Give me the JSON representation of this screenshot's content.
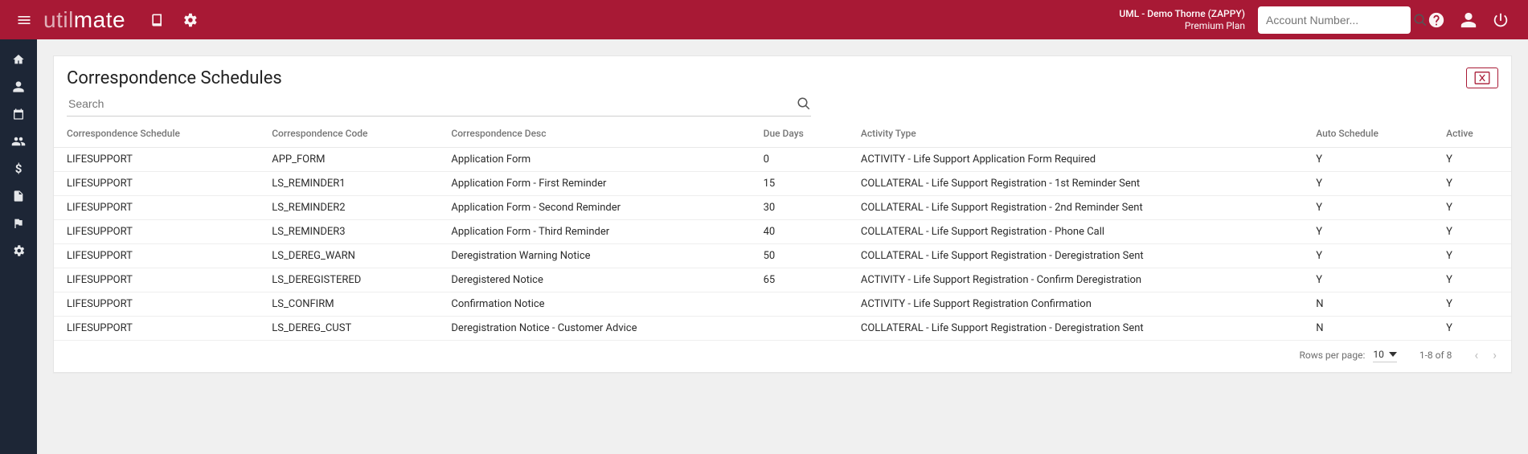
{
  "header": {
    "logo_light": "util",
    "logo_bold": "mate",
    "account_line1": "UML - Demo Thorne (ZAPPY)",
    "account_line2": "Premium Plan",
    "search_placeholder": "Account Number..."
  },
  "page": {
    "title": "Correspondence Schedules",
    "filter_placeholder": "Search"
  },
  "columns": [
    "Correspondence Schedule",
    "Correspondence Code",
    "Correspondence Desc",
    "Due Days",
    "Activity Type",
    "Auto Schedule",
    "Active"
  ],
  "rows": [
    {
      "schedule": "LIFESUPPORT",
      "code": "APP_FORM",
      "desc": "Application Form",
      "due": "0",
      "activity": "ACTIVITY - Life Support Application Form Required",
      "auto": "Y",
      "active": "Y"
    },
    {
      "schedule": "LIFESUPPORT",
      "code": "LS_REMINDER1",
      "desc": "Application Form - First Reminder",
      "due": "15",
      "activity": "COLLATERAL - Life Support Registration - 1st Reminder Sent",
      "auto": "Y",
      "active": "Y"
    },
    {
      "schedule": "LIFESUPPORT",
      "code": "LS_REMINDER2",
      "desc": "Application Form - Second Reminder",
      "due": "30",
      "activity": "COLLATERAL - Life Support Registration - 2nd Reminder Sent",
      "auto": "Y",
      "active": "Y"
    },
    {
      "schedule": "LIFESUPPORT",
      "code": "LS_REMINDER3",
      "desc": "Application Form - Third Reminder",
      "due": "40",
      "activity": "COLLATERAL - Life Support Registration - Phone Call",
      "auto": "Y",
      "active": "Y"
    },
    {
      "schedule": "LIFESUPPORT",
      "code": "LS_DEREG_WARN",
      "desc": "Deregistration Warning Notice",
      "due": "50",
      "activity": "COLLATERAL - Life Support Registration - Deregistration Sent",
      "auto": "Y",
      "active": "Y"
    },
    {
      "schedule": "LIFESUPPORT",
      "code": "LS_DEREGISTERED",
      "desc": "Deregistered Notice",
      "due": "65",
      "activity": "ACTIVITY - Life Support Registration - Confirm Deregistration",
      "auto": "Y",
      "active": "Y"
    },
    {
      "schedule": "LIFESUPPORT",
      "code": "LS_CONFIRM",
      "desc": "Confirmation Notice",
      "due": "",
      "activity": "ACTIVITY - Life Support Registration Confirmation",
      "auto": "N",
      "active": "Y"
    },
    {
      "schedule": "LIFESUPPORT",
      "code": "LS_DEREG_CUST",
      "desc": "Deregistration Notice - Customer Advice",
      "due": "",
      "activity": "COLLATERAL - Life Support Registration - Deregistration Sent",
      "auto": "N",
      "active": "Y"
    }
  ],
  "paginator": {
    "rows_per_page_label": "Rows per page:",
    "rows_per_page_value": "10",
    "range_label": "1-8 of 8"
  }
}
